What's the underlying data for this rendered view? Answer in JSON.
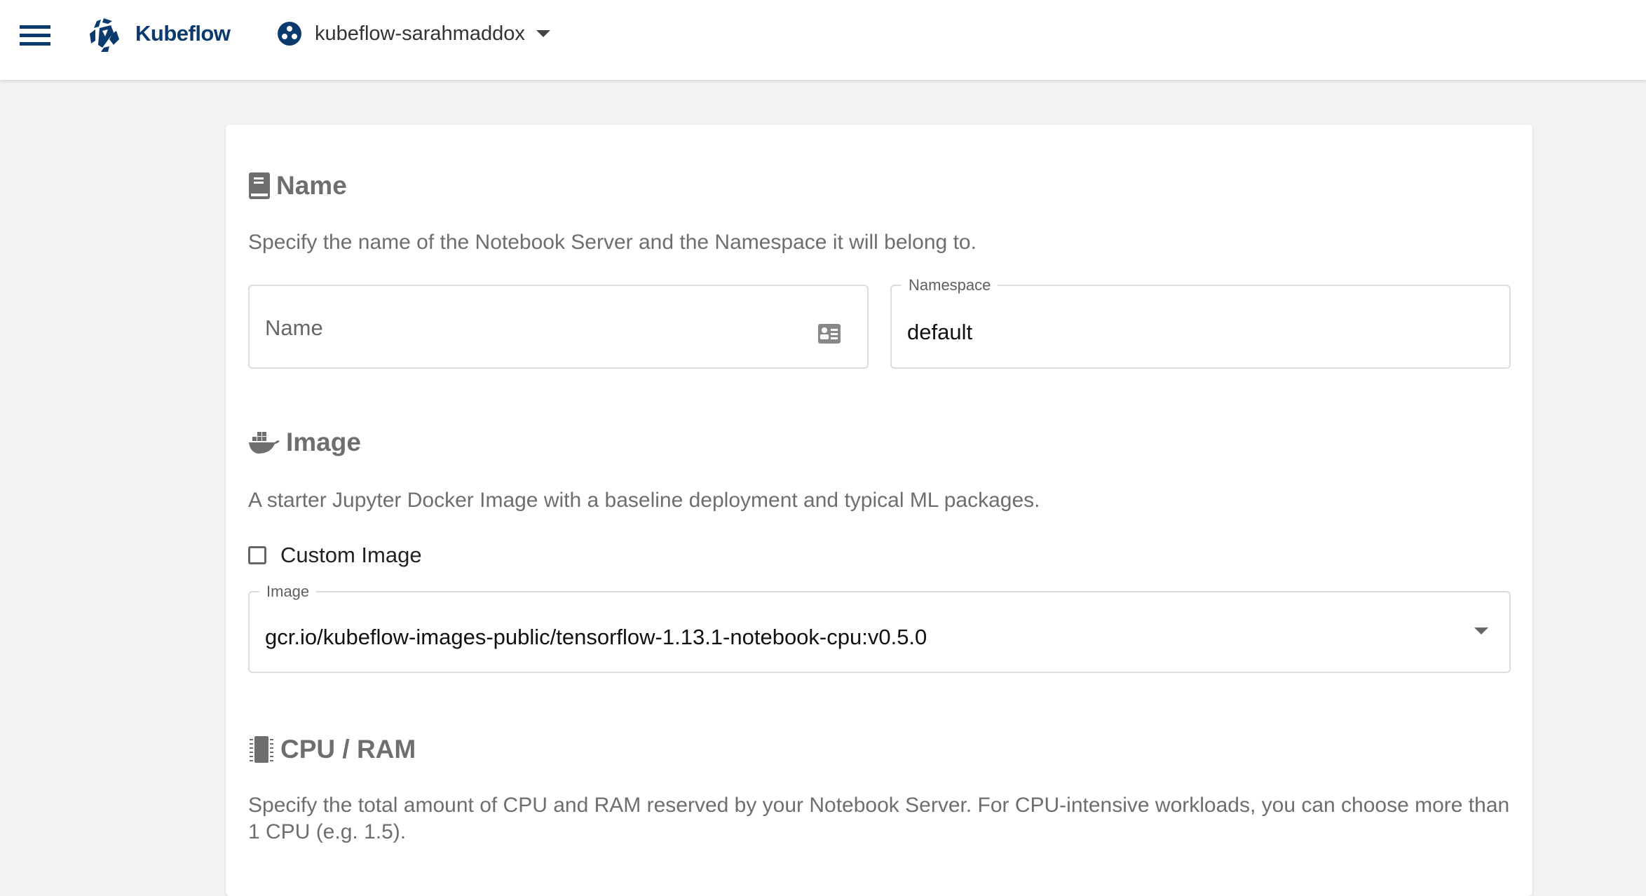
{
  "header": {
    "brand": "Kubeflow",
    "namespace_selector": "kubeflow-sarahmaddox"
  },
  "name_section": {
    "title": "Name",
    "description": "Specify the name of the Notebook Server and the Namespace it will belong to.",
    "name_field": {
      "placeholder": "Name",
      "value": ""
    },
    "namespace_field": {
      "label": "Namespace",
      "value": "default"
    }
  },
  "image_section": {
    "title": "Image",
    "description": "A starter Jupyter Docker Image with a baseline deployment and typical ML packages.",
    "custom_image_label": "Custom Image",
    "custom_image_checked": false,
    "image_field": {
      "label": "Image",
      "value": "gcr.io/kubeflow-images-public/tensorflow-1.13.1-notebook-cpu:v0.5.0"
    }
  },
  "cpu_section": {
    "title": "CPU / RAM",
    "description": "Specify the total amount of CPU and RAM reserved by your Notebook Server. For CPU-intensive workloads, you can choose more than 1 CPU (e.g. 1.5)."
  },
  "colors": {
    "brand": "#0a3a6e",
    "heading": "#6e6e6e"
  }
}
